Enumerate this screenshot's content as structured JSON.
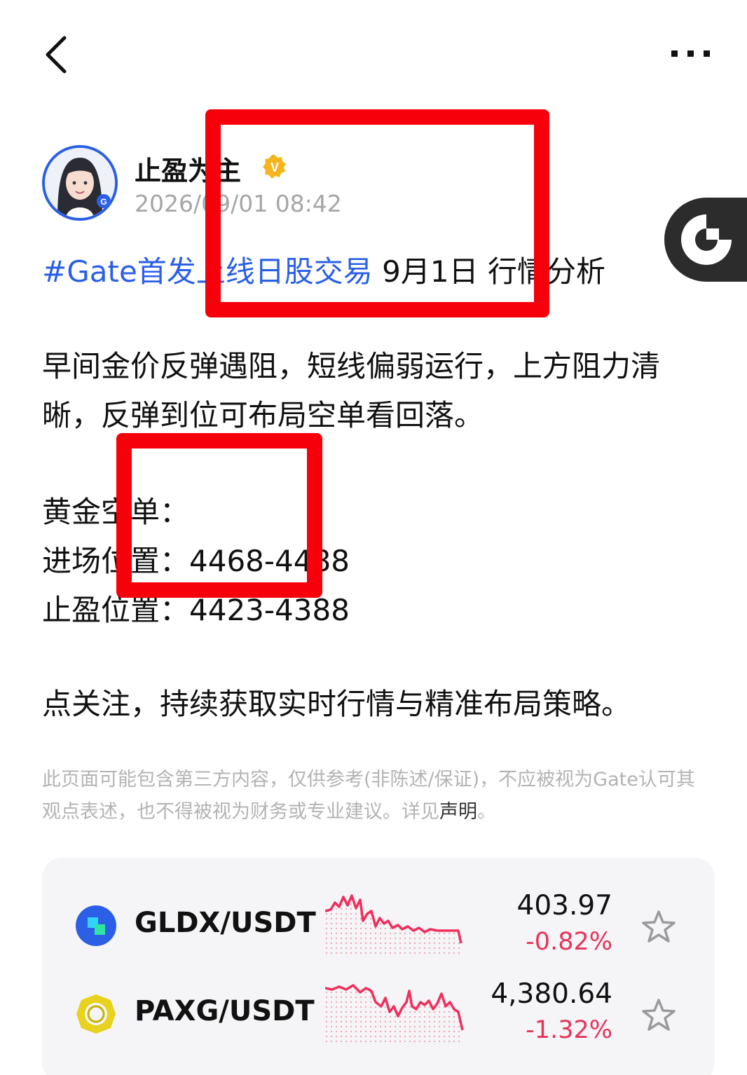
{
  "nav": {
    "back_icon": "chevron-left-icon",
    "more_icon": "more-horizontal-icon"
  },
  "author": {
    "name": "止盈为主",
    "verified_icon": "verified-badge-icon",
    "time": "2026/09/01 08:42"
  },
  "float_button_icon": "gate-logo-icon",
  "post": {
    "hashtag": "#Gate首发上线日股交易",
    "title_rest": " 9月1日 行情分析",
    "para1_line1": "早间金价反弹遇阻，短线偏弱运行，上方阻力清",
    "para1_line2": "晰，反弹到位可布局空单看回落。",
    "section_title": "黄金空单：",
    "entry": "进场位置：4468-4488",
    "take_profit": "止盈位置：4423-4388",
    "cta": "点关注，持续获取实时行情与精准布局策略。"
  },
  "disclaimer": {
    "text": "此页面可能包含第三方内容，仅供参考(非陈述/保证)，不应被视为Gate认可其观点表述，也不得被视为财务或专业建议。详见",
    "link_label": "声明",
    "end": "。"
  },
  "tickers": [
    {
      "pair": "GLDX/USDT",
      "price": "403.97",
      "change": "-0.82%",
      "icon": "gldx-coin-icon"
    },
    {
      "pair": "PAXG/USDT",
      "price": "4,380.64",
      "change": "-1.32%",
      "icon": "paxg-coin-icon"
    }
  ],
  "colors": {
    "accent_blue": "#2a5fe6",
    "negative": "#e8335a",
    "annotation_red": "#f5000b"
  }
}
